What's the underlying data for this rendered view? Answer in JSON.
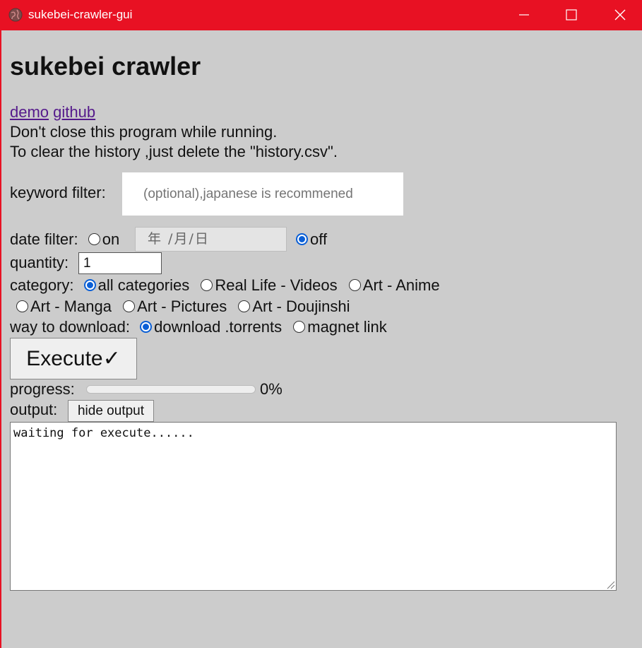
{
  "window": {
    "title": "sukebei-crawler-gui",
    "accent": "#e81123"
  },
  "heading": "sukebei crawler",
  "links": {
    "demo": "demo",
    "github": "github"
  },
  "notes": [
    "Don't close this program while running.",
    "To clear the history ,just delete the \"history.csv\"."
  ],
  "keyword_filter": {
    "label": "keyword filter:",
    "value": "",
    "placeholder": "(optional),japanese is recommened"
  },
  "date_filter": {
    "label": "date filter:",
    "on_label": "on",
    "off_label": "off",
    "selected": "off",
    "date_placeholder": "年 /月/日"
  },
  "quantity": {
    "label": "quantity:",
    "value": "1"
  },
  "category": {
    "label": "category:",
    "options": [
      "all categories",
      "Real Life - Videos",
      "Art - Anime",
      "Art - Manga",
      "Art - Pictures",
      "Art - Doujinshi"
    ],
    "selected": "all categories"
  },
  "download": {
    "label": "way to download:",
    "options": [
      "download .torrents",
      "magnet link"
    ],
    "selected": "download .torrents"
  },
  "execute_label": "Execute✓",
  "progress": {
    "label": "progress:",
    "value": 0,
    "text": "0%"
  },
  "output": {
    "label": "output:",
    "toggle_label": "hide output",
    "text": "waiting for execute......"
  }
}
